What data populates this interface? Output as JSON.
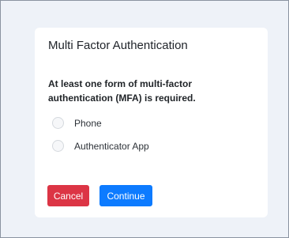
{
  "dialog": {
    "title": "Multi Factor Authentication",
    "description": "At least one form of multi-factor authentication (MFA) is required.",
    "options": [
      {
        "label": "Phone",
        "selected": false
      },
      {
        "label": "Authenticator App",
        "selected": false
      }
    ],
    "buttons": {
      "cancel_label": "Cancel",
      "continue_label": "Continue"
    }
  },
  "colors": {
    "background": "#eef2f8",
    "card": "#ffffff",
    "cancel": "#dc3545",
    "continue": "#0d7bff"
  }
}
